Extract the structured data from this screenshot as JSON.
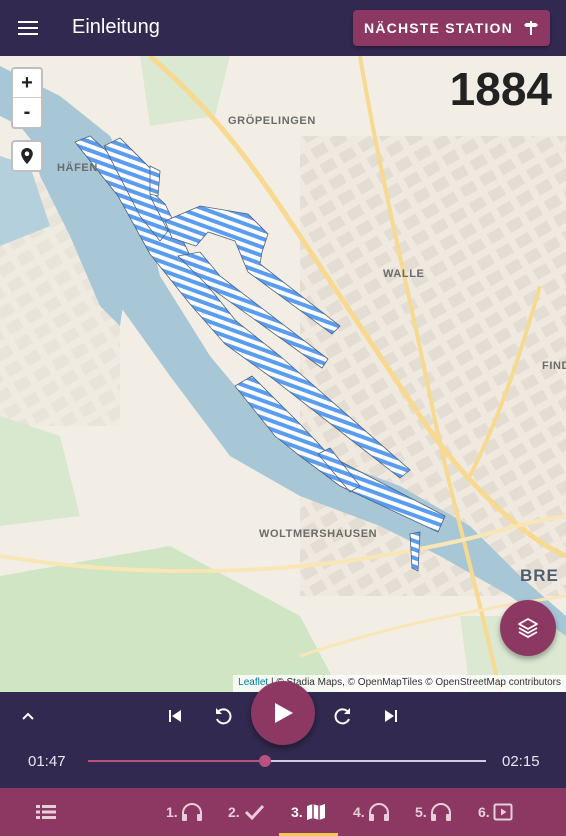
{
  "appbar": {
    "title": "Einleitung",
    "next_button_label": "NÄCHSTE STATION"
  },
  "map": {
    "year": "1884",
    "zoom_in": "+",
    "zoom_out": "-",
    "labels": {
      "groepelingen": "GRÖPELINGEN",
      "haefen": "HÄFEN",
      "walle": "WALLE",
      "find": "FIND",
      "woltmershausen": "WOLTMERSHAUSEN",
      "bre": "BRE"
    },
    "attribution": {
      "leaflet": "Leaflet",
      "rest": " | © Stadia Maps, © OpenMapTiles © OpenStreetMap contributors"
    }
  },
  "player": {
    "current_time": "01:47",
    "total_time": "02:15",
    "progress": 0.444
  },
  "nav": {
    "items": [
      {
        "num": "1.",
        "icon": "headphones-icon"
      },
      {
        "num": "2.",
        "icon": "check-icon"
      },
      {
        "num": "3.",
        "icon": "map-icon"
      },
      {
        "num": "4.",
        "icon": "headphones-icon"
      },
      {
        "num": "5.",
        "icon": "headphones-icon"
      },
      {
        "num": "6.",
        "icon": "video-icon"
      }
    ],
    "active_index": 2
  },
  "colors": {
    "primary": "#31294f",
    "accent": "#8d3763",
    "indicator": "#f2c94c",
    "overlay_stripe": "#5a9cf0"
  }
}
